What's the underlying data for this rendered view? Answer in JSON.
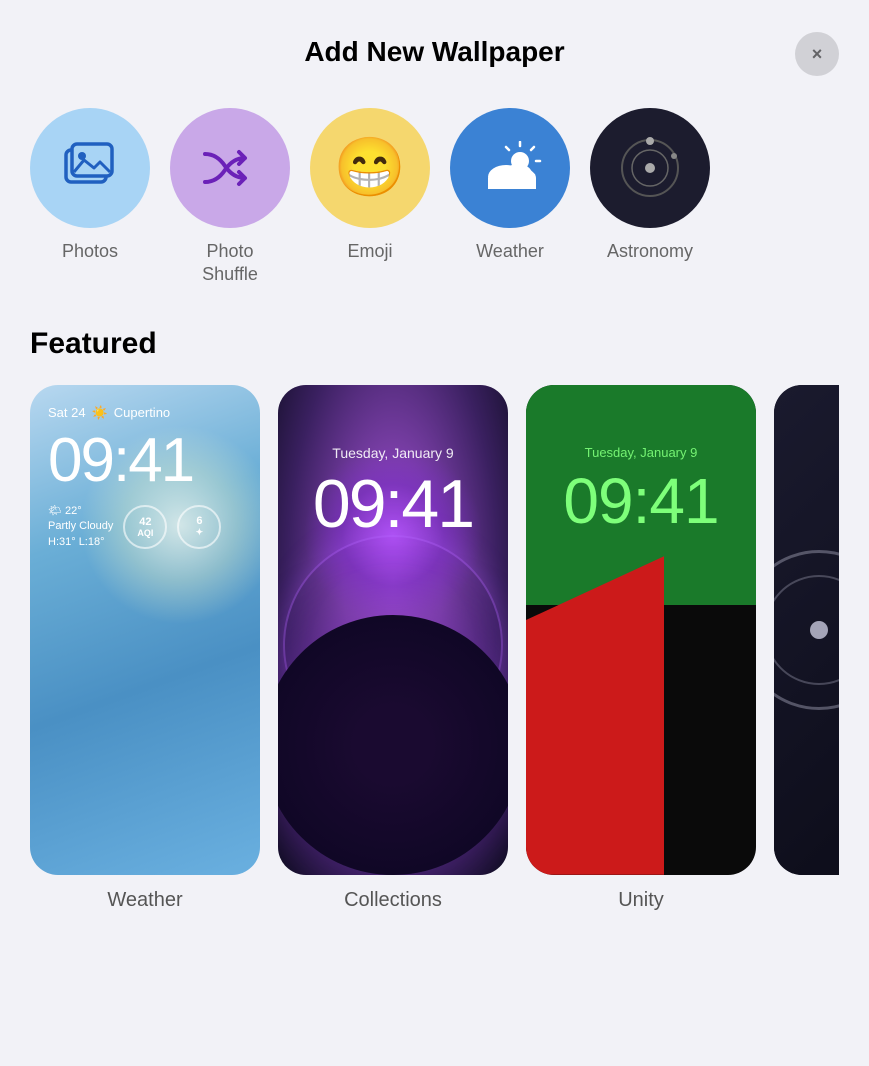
{
  "header": {
    "title": "Add New Wallpaper",
    "close_label": "×"
  },
  "wallpaper_types": [
    {
      "id": "photos",
      "label": "Photos",
      "circle_class": "circle-photos",
      "icon": "🖼",
      "icon_type": "photos"
    },
    {
      "id": "photo-shuffle",
      "label": "Photo\nShuffle",
      "circle_class": "circle-shuffle",
      "icon": "⇄",
      "icon_type": "shuffle"
    },
    {
      "id": "emoji",
      "label": "Emoji",
      "circle_class": "circle-emoji",
      "icon": "😁",
      "icon_type": "emoji"
    },
    {
      "id": "weather",
      "label": "Weather",
      "circle_class": "circle-weather",
      "icon": "⛅",
      "icon_type": "weather"
    },
    {
      "id": "astronomy",
      "label": "Astronomy",
      "circle_class": "circle-astronomy",
      "icon": "🔭",
      "icon_type": "astronomy"
    }
  ],
  "featured": {
    "title": "Featured",
    "items": [
      {
        "id": "weather-wp",
        "label": "Weather",
        "date": "Sat 24",
        "location": "Cupertino",
        "time": "09:41",
        "temp": "22°",
        "condition": "Partly Cloudy",
        "hi_lo": "H:31° L:18°",
        "aqi": "42",
        "stars": "6"
      },
      {
        "id": "collections-wp",
        "label": "Collections",
        "date": "Tuesday, January 9",
        "time": "09:41"
      },
      {
        "id": "unity-wp",
        "label": "Unity",
        "date": "Tuesday, January 9",
        "time": "09:41"
      }
    ]
  }
}
